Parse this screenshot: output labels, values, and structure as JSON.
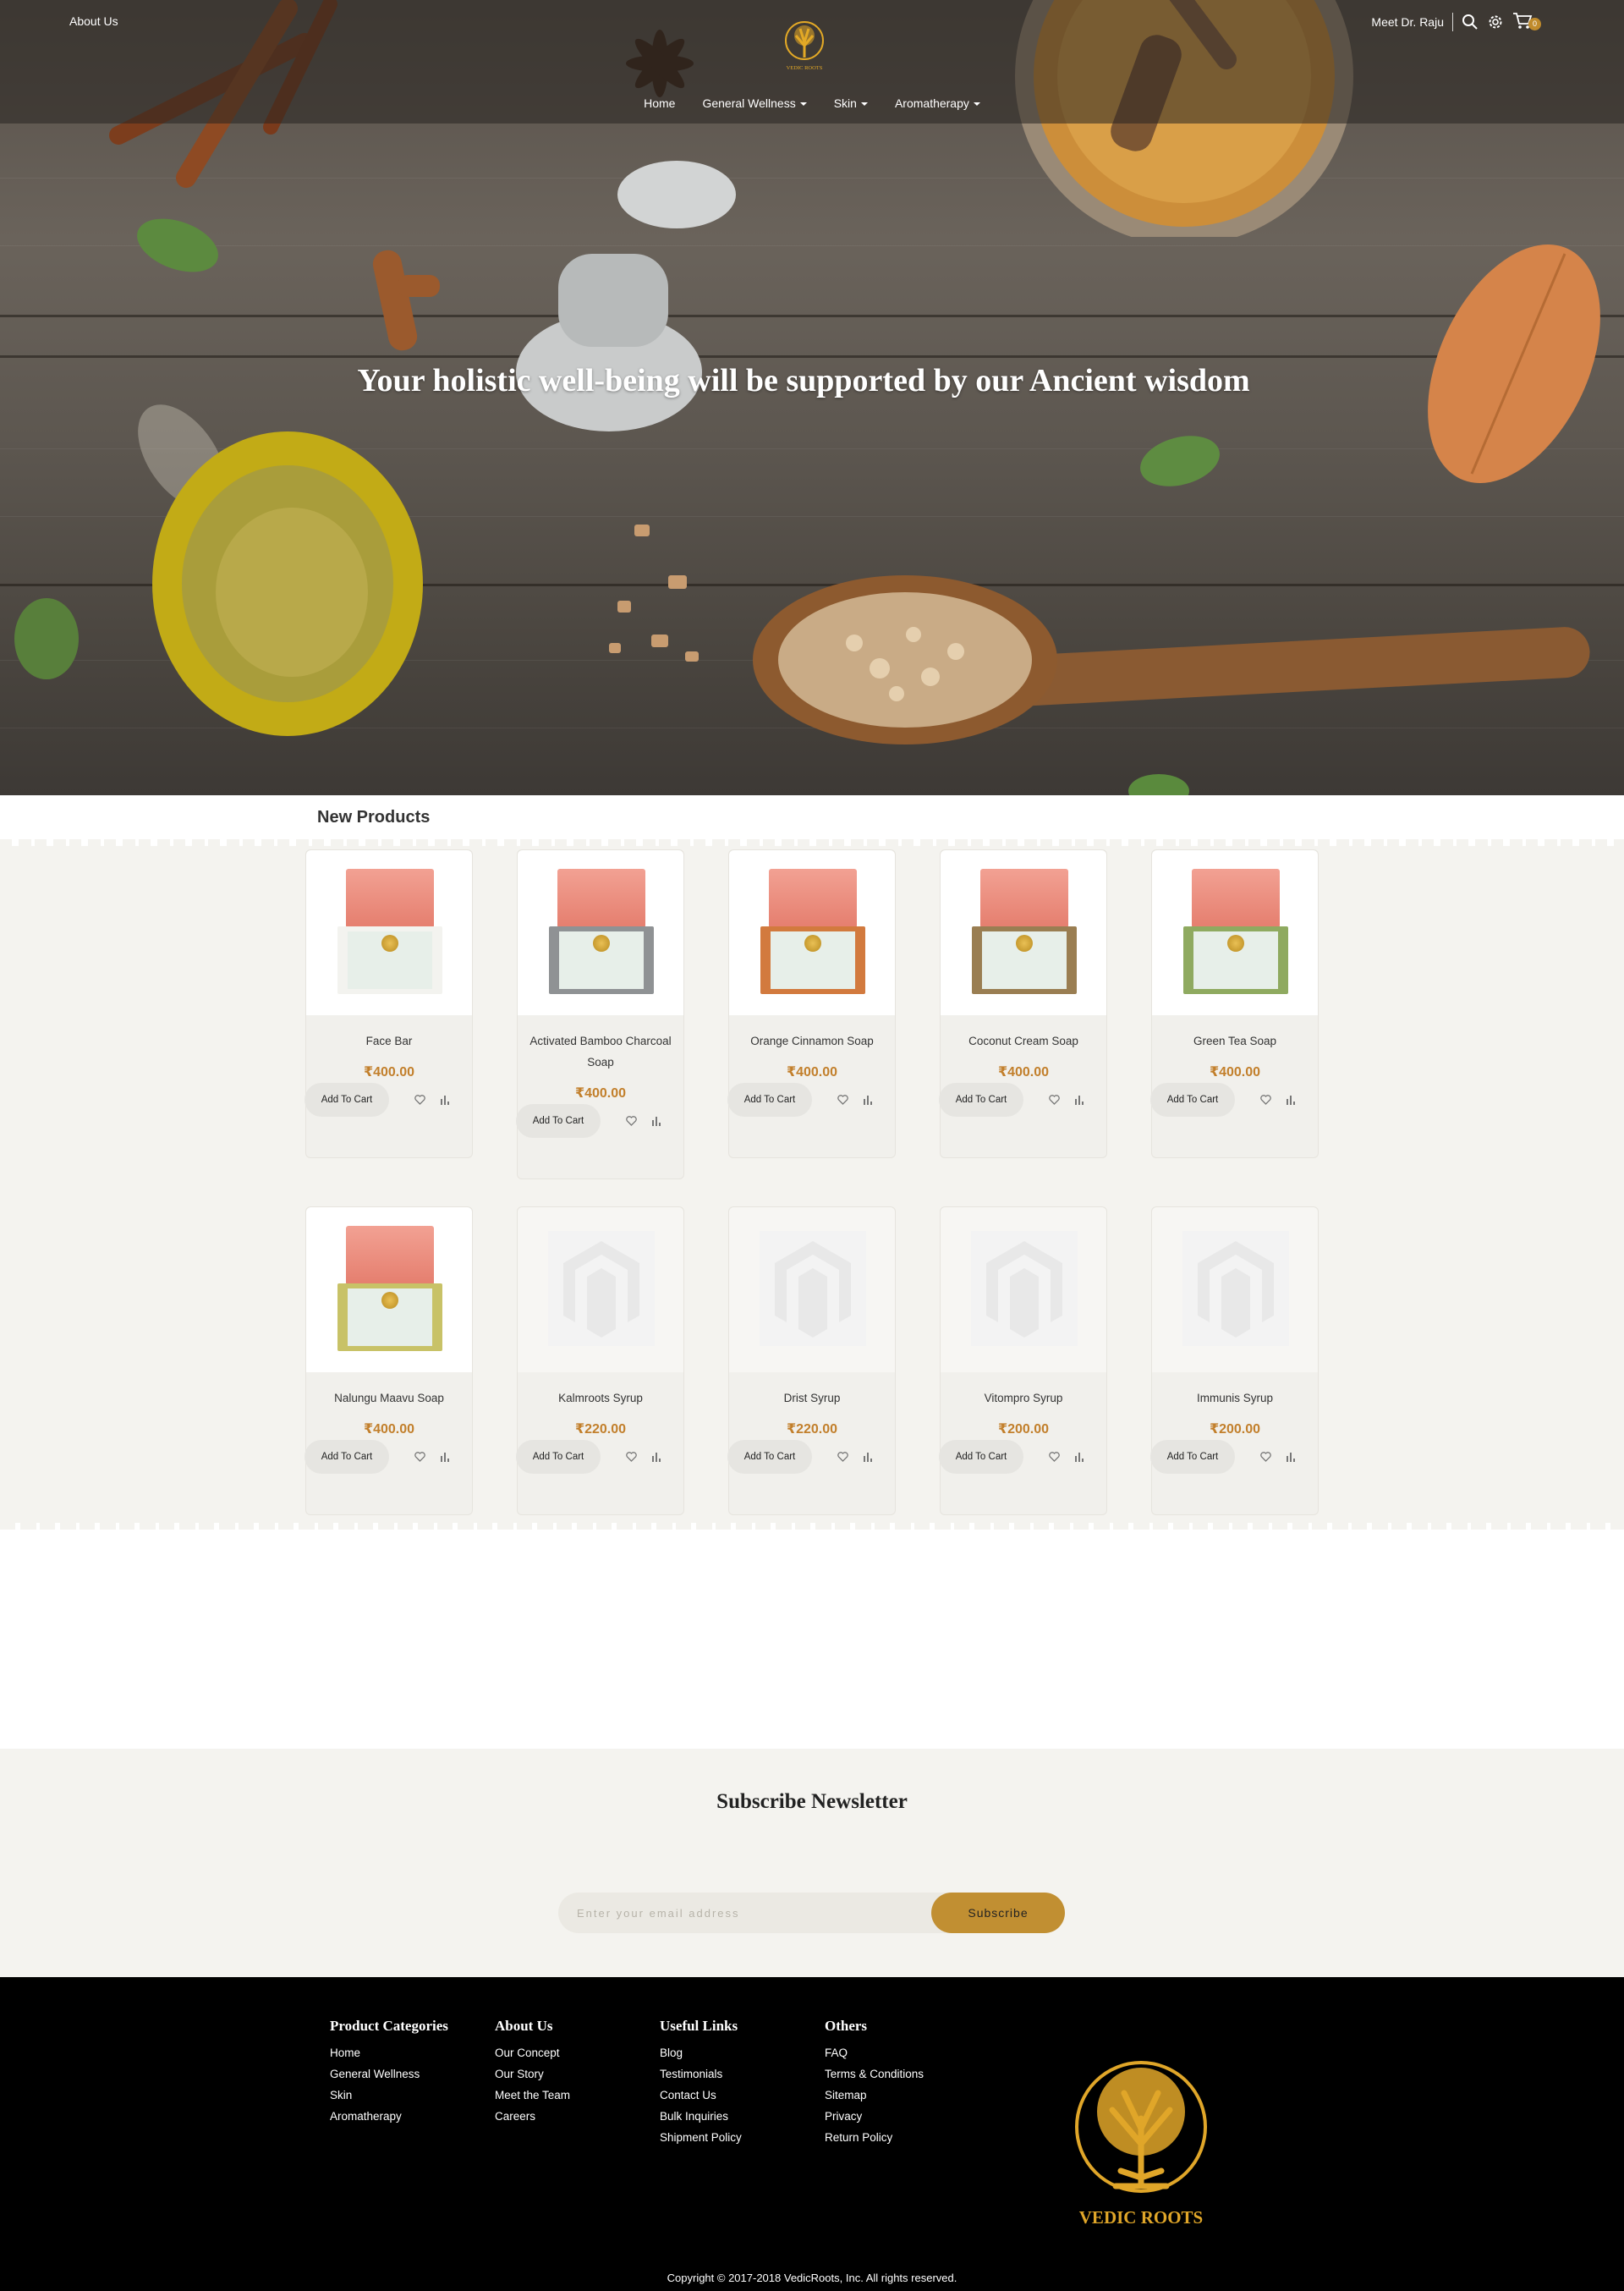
{
  "header": {
    "about_link": "About Us",
    "logo_text": "VEDIC ROOTS",
    "nav": [
      {
        "label": "Home",
        "has_dropdown": false
      },
      {
        "label": "General Wellness",
        "has_dropdown": true
      },
      {
        "label": "Skin",
        "has_dropdown": true
      },
      {
        "label": "Aromatherapy",
        "has_dropdown": true
      }
    ],
    "meet_link": "Meet Dr. Raju",
    "cart_count": "0",
    "icons": [
      "search-icon",
      "gear-icon",
      "cart-icon"
    ]
  },
  "hero": {
    "headline": "Your holistic well-being will be supported by our Ancient wisdom"
  },
  "new_products": {
    "title": "New Products",
    "add_to_cart_label": "Add To Cart",
    "items": [
      {
        "name": "Face Bar",
        "price": "₹400.00",
        "box_color": "#f3f3ef",
        "has_image": true
      },
      {
        "name": "Activated Bamboo Charcoal Soap",
        "price": "₹400.00",
        "box_color": "#8f9294",
        "has_image": true
      },
      {
        "name": "Orange Cinnamon Soap",
        "price": "₹400.00",
        "box_color": "#d27a3e",
        "has_image": true
      },
      {
        "name": "Coconut Cream Soap",
        "price": "₹400.00",
        "box_color": "#9a7e52",
        "has_image": true
      },
      {
        "name": "Green Tea Soap",
        "price": "₹400.00",
        "box_color": "#8faa60",
        "has_image": true
      },
      {
        "name": "Nalungu Maavu Soap",
        "price": "₹400.00",
        "box_color": "#c8c267",
        "has_image": true
      },
      {
        "name": "Kalmroots Syrup",
        "price": "₹220.00",
        "has_image": false
      },
      {
        "name": "Drist Syrup",
        "price": "₹220.00",
        "has_image": false
      },
      {
        "name": "Vitompro Syrup",
        "price": "₹200.00",
        "has_image": false
      },
      {
        "name": "Immunis Syrup",
        "price": "₹200.00",
        "has_image": false
      }
    ]
  },
  "newsletter": {
    "title": "Subscribe Newsletter",
    "placeholder": "Enter your email address",
    "button": "Subscribe"
  },
  "footer": {
    "columns": [
      {
        "title": "Product Categories",
        "links": [
          "Home",
          "General Wellness",
          "Skin",
          "Aromatherapy"
        ]
      },
      {
        "title": "About Us",
        "links": [
          "Our Concept",
          "Our Story",
          "Meet the Team",
          "Careers"
        ]
      },
      {
        "title": "Useful Links",
        "links": [
          "Blog",
          "Testimonials",
          "Contact Us",
          "Bulk Inquiries",
          "Shipment Policy"
        ]
      },
      {
        "title": "Others",
        "links": [
          "FAQ",
          "Terms & Conditions",
          "Sitemap",
          "Privacy",
          "Return Policy"
        ]
      }
    ],
    "logo_text": "VEDIC ROOTS",
    "copyright": "Copyright © 2017-2018 VedicRoots, Inc. All rights reserved."
  },
  "colors": {
    "accent": "#c18f32",
    "price": "#c27f2b",
    "band": "#f4f3ef",
    "footer": "#000000"
  }
}
